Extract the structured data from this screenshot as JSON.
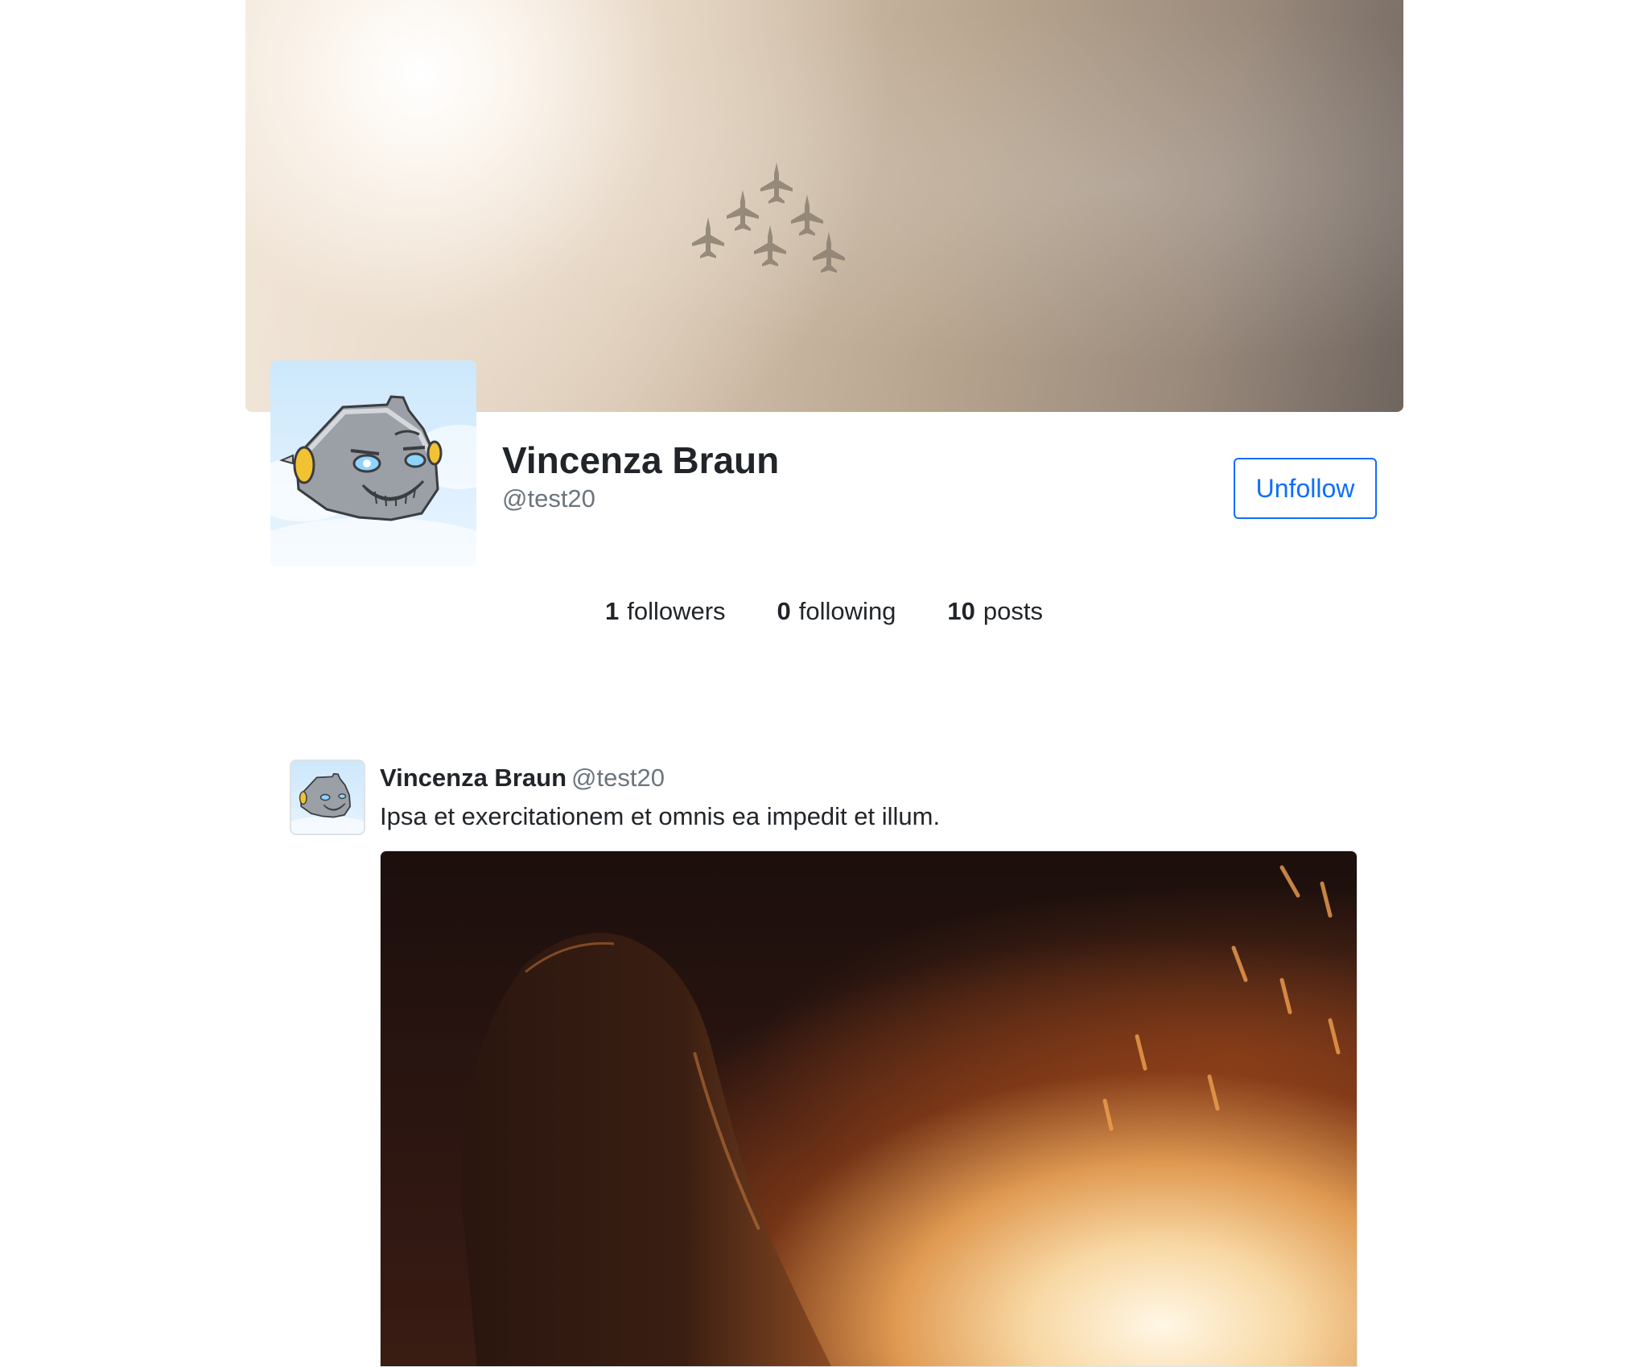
{
  "profile": {
    "name": "Vincenza Braun",
    "handle": "@test20",
    "unfollow_label": "Unfollow",
    "avatar_icon": "robot-avatar-icon",
    "cover_image": "jets-formation-cover"
  },
  "stats": [
    {
      "value": "1",
      "label": "followers"
    },
    {
      "value": "0",
      "label": "following"
    },
    {
      "value": "10",
      "label": "posts"
    }
  ],
  "post": {
    "author": "Vincenza Braun",
    "handle": "@test20",
    "text": "Ipsa et exercitationem et omnis ea impedit et illum.",
    "image": "woman-by-fire-photo"
  },
  "colors": {
    "accent": "#0d6efd",
    "muted": "#6c757d",
    "text": "#212529"
  }
}
